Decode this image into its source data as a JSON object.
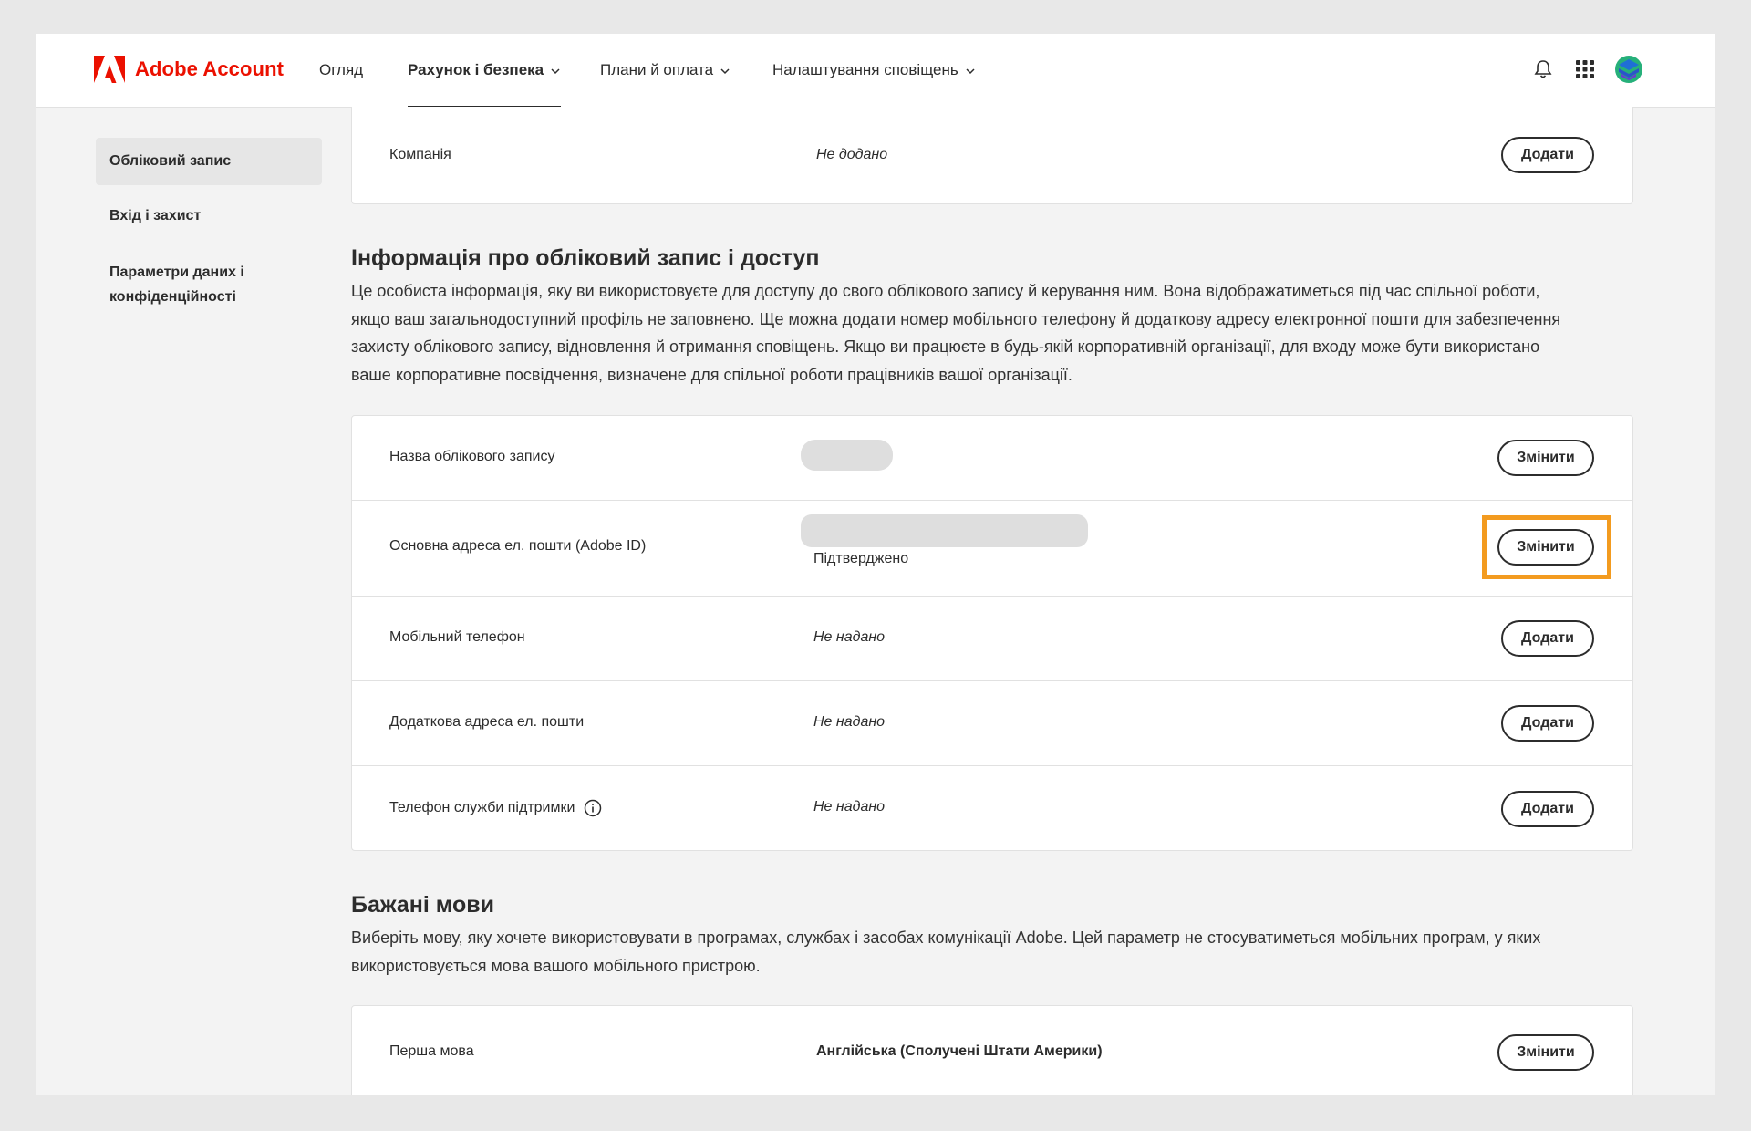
{
  "brand": {
    "name": "Adobe Account",
    "color": "#eb1000"
  },
  "nav": {
    "items": [
      {
        "label": "Огляд"
      },
      {
        "label": "Рахунок і безпека"
      },
      {
        "label": "Плани й оплата"
      },
      {
        "label": "Налаштування сповіщень"
      }
    ],
    "icons": [
      "bell-icon",
      "apps-grid-icon",
      "avatar"
    ]
  },
  "sidebar": {
    "items": [
      {
        "label": "Обліковий запис"
      },
      {
        "label": "Вхід і захист"
      },
      {
        "label": "Параметри даних і конфіденційності"
      }
    ]
  },
  "company": {
    "label": "Компанія",
    "value": "Не додано",
    "button": "Додати"
  },
  "access_section": {
    "title": "Інформація про обліковий запис і доступ",
    "description_lines": [
      "Це особиста інформація, яку ви використовуєте для доступу до свого облікового запису й керування ним. Вона відображатиметься під час спільної роботи,",
      "якщо ваш загальнодоступний профіль не заповнено. Ще можна додати номер мобільного телефону й додаткову адресу електронної пошти для забезпечення",
      "захисту облікового запису, відновлення й отримання сповіщень. Якщо ви працюєте в будь-якій корпоративній організації, для входу може бути використано",
      "ваше корпоративне посвідчення, визначене для спільної роботи працівників вашої організації."
    ],
    "rows": [
      {
        "label": "Назва облікового запису",
        "value": "",
        "button": "Змінити"
      },
      {
        "label": "Основна адреса ел. пошти (Adobe ID)",
        "value": "Підтверджено",
        "button": "Змінити"
      },
      {
        "label": "Мобільний телефон",
        "value": "Не надано",
        "button": "Додати"
      },
      {
        "label": "Додаткова адреса ел. пошти",
        "value": "Не надано",
        "button": "Додати"
      },
      {
        "label": "Телефон служби підтримки",
        "value": "Не надано",
        "button": "Додати"
      }
    ]
  },
  "languages_section": {
    "title": "Бажані мови",
    "description_lines": [
      "Виберіть мову, яку хочете використовувати в програмах, службах і засобах комунікації Adobe. Цей параметр не стосуватиметься мобільних програм, у яких",
      "використовується мова вашого мобільного пристрою."
    ],
    "rows": [
      {
        "label": "Перша мова",
        "value": "Англійська (Сполучені Штати Америки)",
        "button": "Змінити"
      }
    ]
  },
  "colors": {
    "highlight": "#f39b1f",
    "text": "#2c2c2c",
    "page_bg": "#f3f3f3"
  }
}
